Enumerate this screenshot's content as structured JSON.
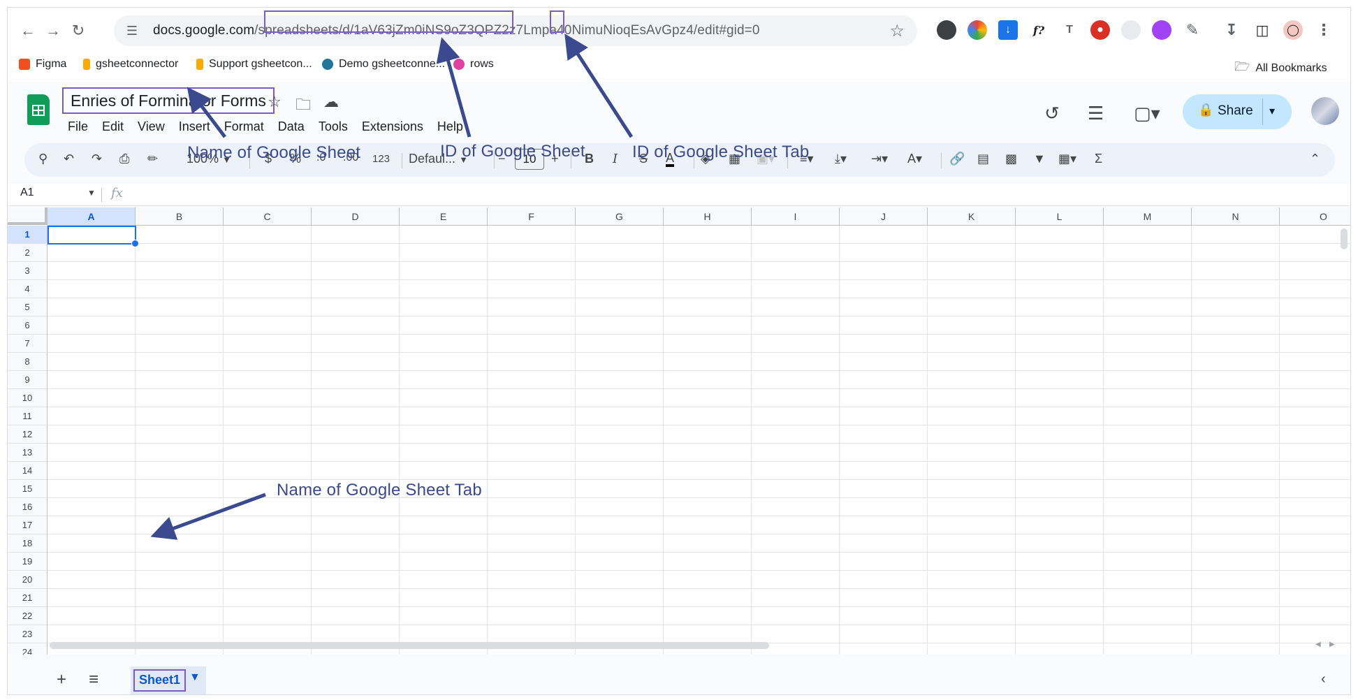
{
  "browser": {
    "url_domain": "docs.google.com",
    "url_path_prefix": "/spreadsheets/d/",
    "url_sheet_id": "1aV63jZm0iNS9oZ3QPZ2z7Lmpa40NimuNioqEsAvGpz4",
    "url_suffix": "/edit#gid=",
    "url_gid": "0",
    "bookmarks": [
      "Figma",
      "gsheetconnector",
      "Support gsheetcon...",
      "Demo gsheetconne...",
      "rows"
    ],
    "all_bookmarks": "All Bookmarks"
  },
  "doc": {
    "title": "Enries of Forminator Forms",
    "menu": [
      "File",
      "Edit",
      "View",
      "Insert",
      "Format",
      "Data",
      "Tools",
      "Extensions",
      "Help"
    ],
    "share_label": "Share"
  },
  "toolbar": {
    "zoom": "100%",
    "currency": "$",
    "percent": "%",
    "dec_decrease": ".0",
    "dec_increase": ".00",
    "number_format": "123",
    "font": "Defaul...",
    "font_size": "10"
  },
  "formula_bar": {
    "name_box": "A1",
    "fx": "fx"
  },
  "grid": {
    "columns": [
      "A",
      "B",
      "C",
      "D",
      "E",
      "F",
      "G",
      "H",
      "I",
      "J",
      "K",
      "L",
      "M",
      "N",
      "O"
    ],
    "rows": [
      "1",
      "2",
      "3",
      "4",
      "5",
      "6",
      "7",
      "8",
      "9",
      "10",
      "11",
      "12",
      "13",
      "14",
      "15",
      "16",
      "17",
      "18",
      "19",
      "20",
      "21",
      "22",
      "23",
      "24"
    ],
    "active_cell": "A1"
  },
  "sheets": {
    "tabs": [
      "Sheet1"
    ]
  },
  "annotations": {
    "sheet_name": "Name of Google Sheet",
    "sheet_id": "ID of Google Sheet",
    "tab_id": "ID of Google Sheet Tab",
    "tab_name": "Name of Google Sheet Tab"
  },
  "colors": {
    "accent": "#1a73e8",
    "annotation": "#3b4a8f",
    "highlight_box": "#7b5cc2",
    "sheets_green": "#0f9d58"
  }
}
